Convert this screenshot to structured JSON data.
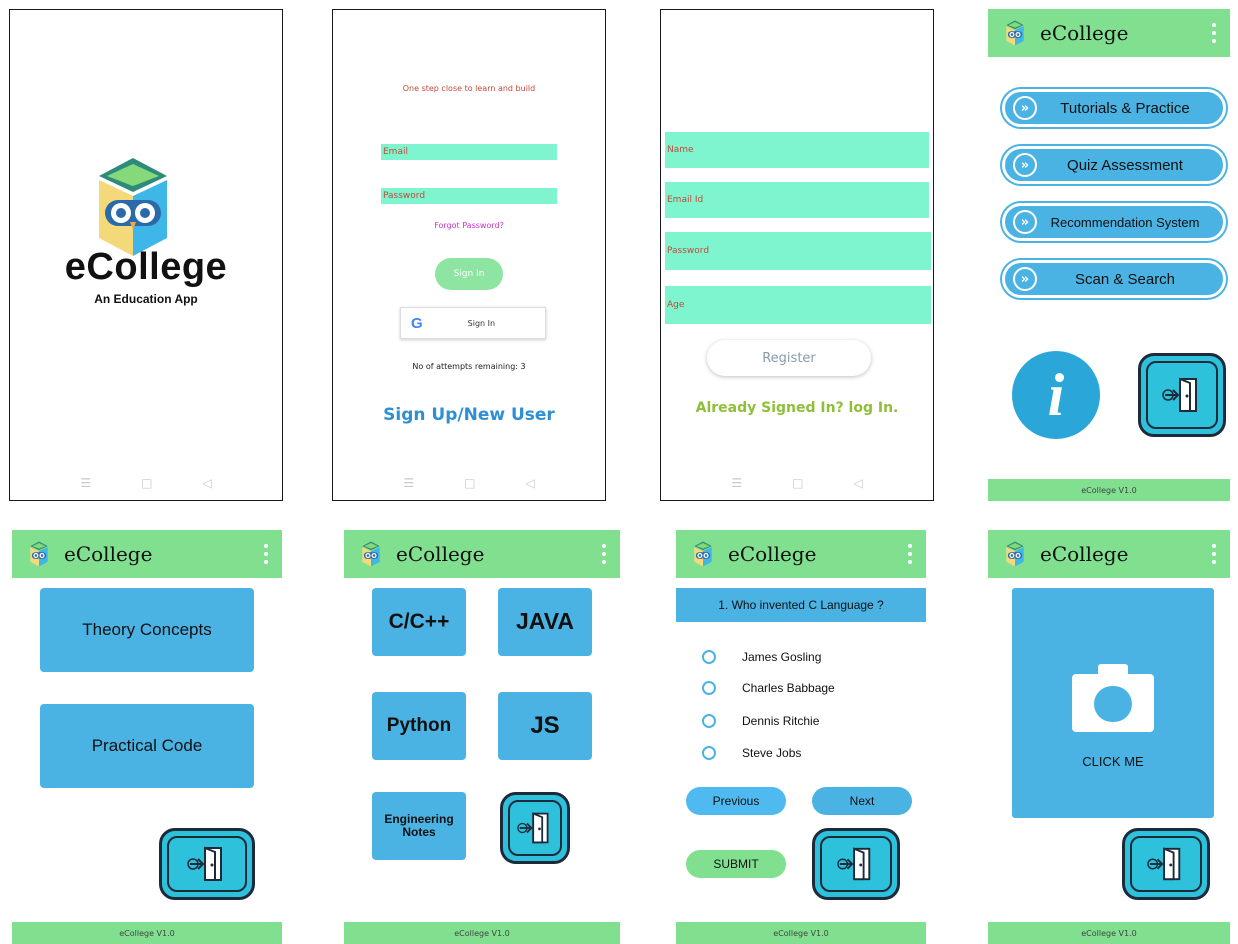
{
  "app_name": "eCollege",
  "version_label": "eCollege V1.0",
  "colors": {
    "header_green": "#80e090",
    "tile_blue": "#4bb3e4",
    "field_mint": "#7ff5cf",
    "exit_teal": "#2ec1dc"
  },
  "splash": {
    "title": "eCollege",
    "subtitle": "An Education App",
    "nav_icons": [
      "menu-icon",
      "home-square-icon",
      "back-triangle-icon"
    ]
  },
  "login": {
    "tagline": "One step close to learn and build",
    "email_placeholder": "Email",
    "password_placeholder": "Password",
    "forgot_label": "Forgot Password?",
    "signin_label": "Sign In",
    "google_signin_label": "Sign In",
    "attempts_label": "No of attempts remaining: 3",
    "signup_label": "Sign Up/New User"
  },
  "register": {
    "fields": [
      "Name",
      "Email Id",
      "Password",
      "Age"
    ],
    "register_label": "Register",
    "already_label": "Already Signed In? log In."
  },
  "dashboard": {
    "menu": [
      {
        "label": "Tutorials & Practice"
      },
      {
        "label": "Quiz Assessment"
      },
      {
        "label": "Recommendation System"
      },
      {
        "label": "Scan & Search"
      }
    ],
    "info_glyph": "i"
  },
  "tutorials": {
    "theory_label": "Theory Concepts",
    "practical_label": "Practical Code"
  },
  "languages": {
    "items": [
      "C/C++",
      "JAVA",
      "Python",
      "JS",
      "Engineering Notes"
    ]
  },
  "quiz": {
    "question": "1. Who invented  C Language ?",
    "options": [
      "James Gosling",
      "Charles Babbage",
      "Dennis Ritchie",
      "Steve Jobs"
    ],
    "previous_label": "Previous",
    "next_label": "Next",
    "submit_label": "SUBMIT"
  },
  "scan": {
    "click_label": "CLICK ME"
  }
}
